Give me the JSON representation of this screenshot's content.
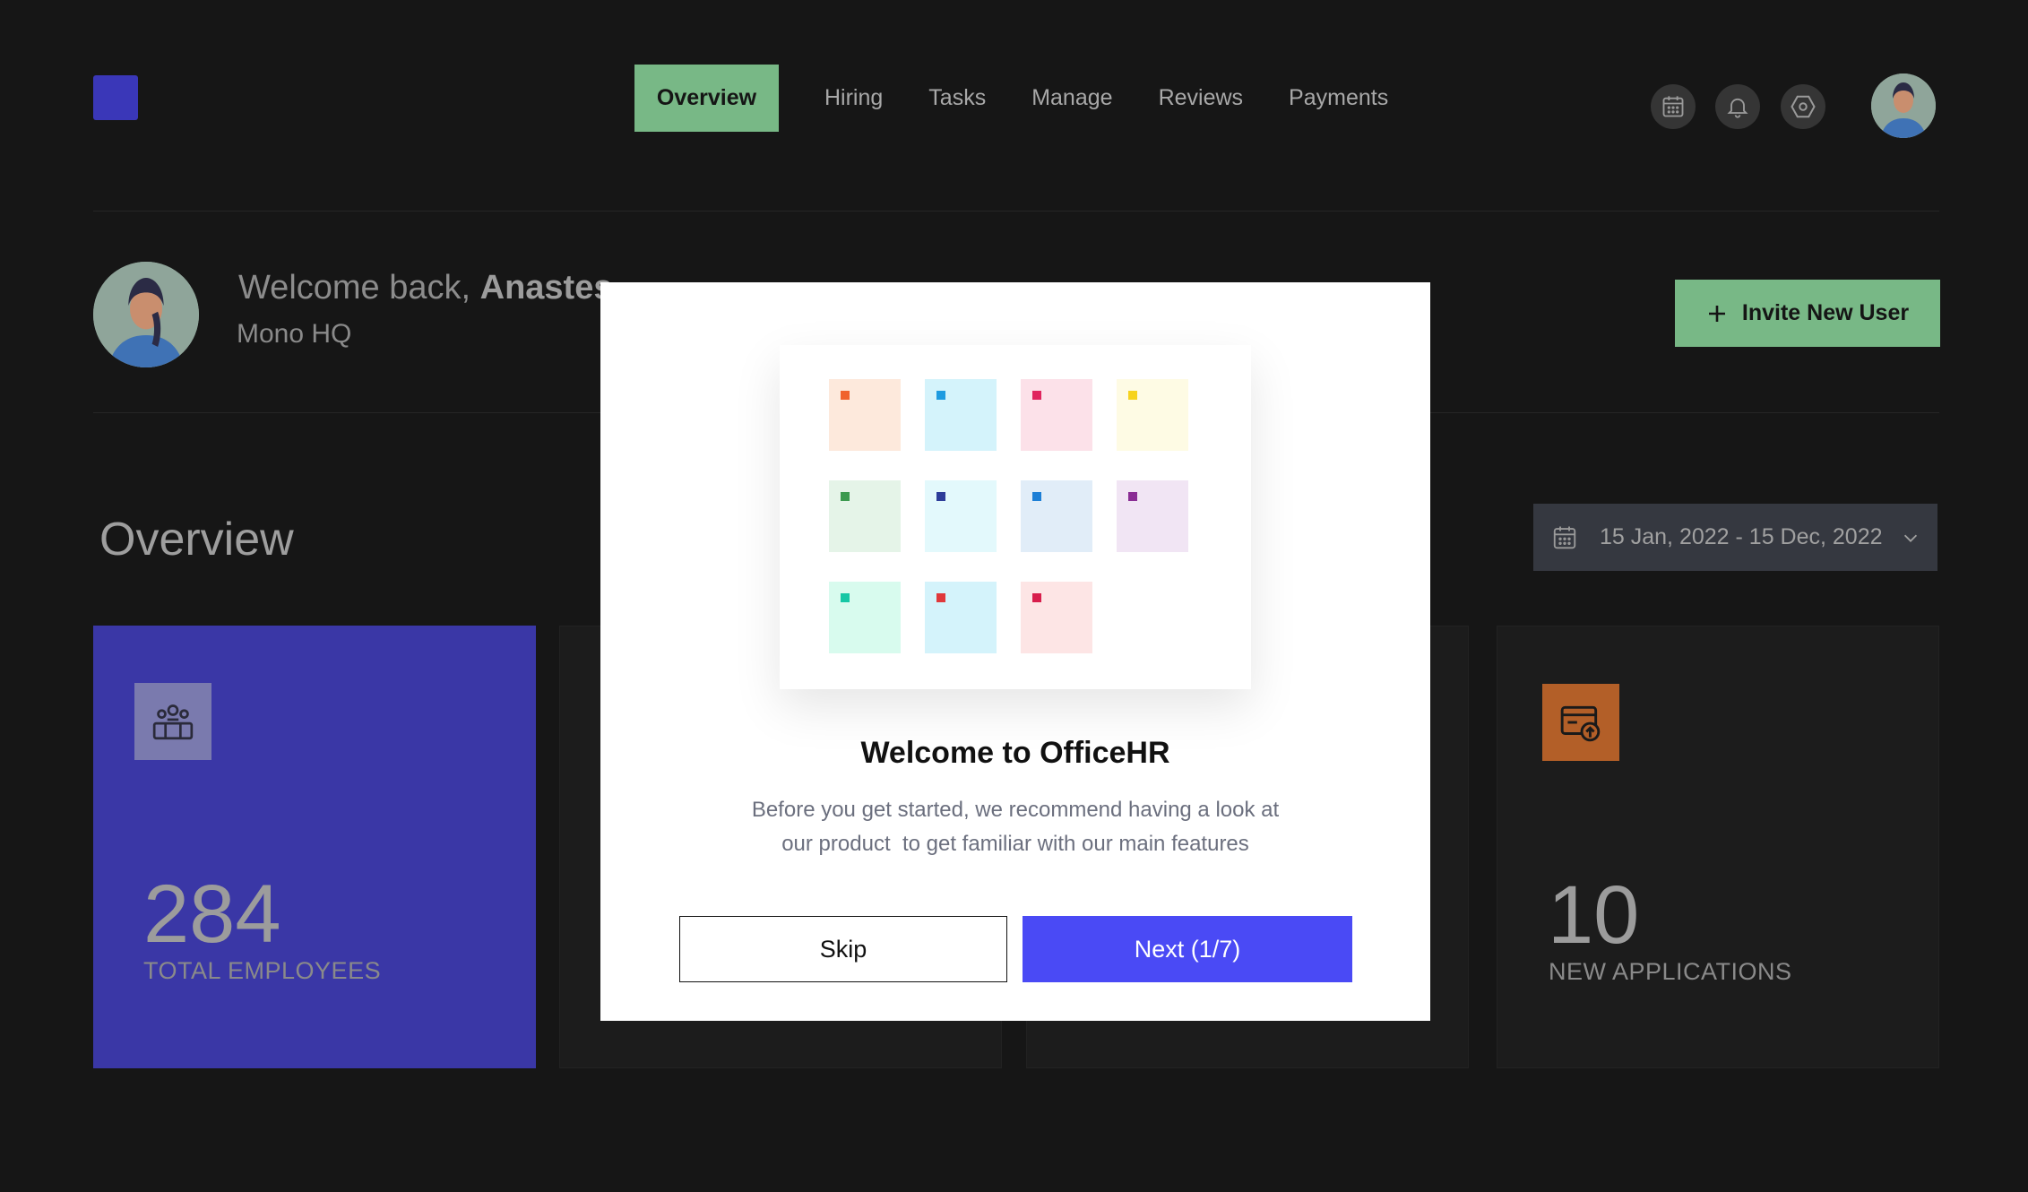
{
  "nav": {
    "items": [
      {
        "label": "Overview",
        "active": true
      },
      {
        "label": "Hiring",
        "active": false
      },
      {
        "label": "Tasks",
        "active": false
      },
      {
        "label": "Manage",
        "active": false
      },
      {
        "label": "Reviews",
        "active": false
      },
      {
        "label": "Payments",
        "active": false
      }
    ]
  },
  "header_icons": [
    "calendar-icon",
    "bell-icon",
    "settings-icon"
  ],
  "welcome": {
    "prefix": "Welcome back, ",
    "name": "Anastes",
    "org": "Mono HQ"
  },
  "invite_button": {
    "label": "Invite New User",
    "icon": "plus-icon"
  },
  "overview": {
    "title": "Overview",
    "date_range": "15 Jan, 2022 - 15 Dec, 2022"
  },
  "cards": [
    {
      "value": "284",
      "label": "TOTAL EMPLOYEES",
      "icon": "team-icon",
      "color": "#3a37a6"
    },
    {
      "value": "10",
      "label": "NEW APPLICATIONS",
      "icon": "application-icon",
      "color": "#b35f28"
    }
  ],
  "modal": {
    "title": "Welcome to OfficeHR",
    "text_line1": "Before you get started, we recommend having a look at",
    "text_line2": "our product  to get familiar with our main features",
    "skip_label": "Skip",
    "next_label": "Next (1/7)",
    "tiles": [
      {
        "bg": "#fde9dc",
        "dot": "#f0622c"
      },
      {
        "bg": "#d4f3fb",
        "dot": "#1e9be0"
      },
      {
        "bg": "#fce1e9",
        "dot": "#e0245e"
      },
      {
        "bg": "#fefbe4",
        "dot": "#f6d31e"
      },
      {
        "bg": "#e5f4e8",
        "dot": "#3c9a4f"
      },
      {
        "bg": "#e3f9fc",
        "dot": "#2d3d99"
      },
      {
        "bg": "#e1edf8",
        "dot": "#1d7fd6"
      },
      {
        "bg": "#f1e5f4",
        "dot": "#8a2d94"
      },
      {
        "bg": "#d8fbee",
        "dot": "#16c7a5"
      },
      {
        "bg": "#d4f3fb",
        "dot": "#e0383b"
      },
      {
        "bg": "#fde5e5",
        "dot": "#d81e4c"
      }
    ]
  },
  "colors": {
    "accent_green": "#78b886",
    "primary_blue": "#4a4af5",
    "background": "#161616"
  }
}
